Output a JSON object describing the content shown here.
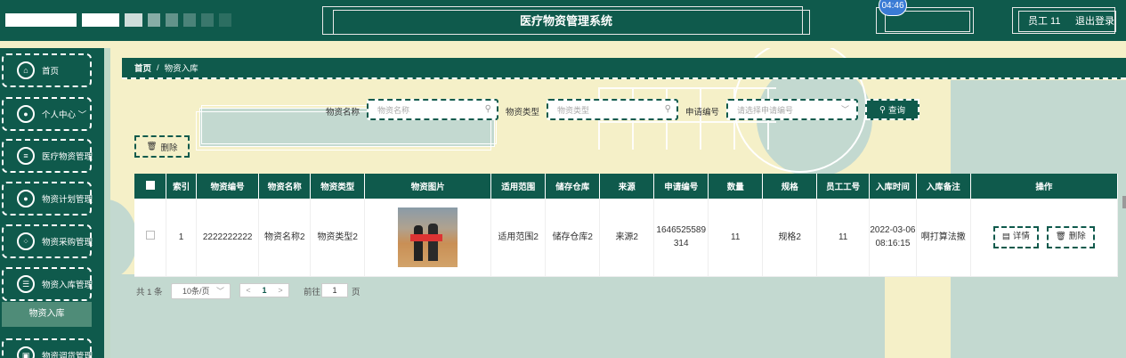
{
  "header": {
    "title": "医疗物资管理系统",
    "time": "04:46",
    "user": "员工 11",
    "logout": "退出登录"
  },
  "sidebar": {
    "items": [
      {
        "label": "首页",
        "icon": "home-icon"
      },
      {
        "label": "个人中心 ﹀",
        "icon": "user-icon"
      },
      {
        "label": "医疗物资管理",
        "icon": "box-icon"
      },
      {
        "label": "物资计划管理",
        "icon": "pin-icon"
      },
      {
        "label": "物资采购管理",
        "icon": "grid-icon"
      },
      {
        "label": "物资入库管理",
        "icon": "list-icon"
      },
      {
        "label": "物资调货管理",
        "icon": "box-icon"
      }
    ],
    "active_sub": "物资入库"
  },
  "breadcrumb": {
    "home": "首页",
    "sep": "/",
    "current": "物资入库"
  },
  "search": {
    "name_label": "物资名称",
    "name_placeholder": "物资名称",
    "type_label": "物资类型",
    "type_placeholder": "物资类型",
    "code_label": "申请编号",
    "code_placeholder": "请选择申请编号",
    "button": "查询"
  },
  "actions": {
    "delete": "删除"
  },
  "table": {
    "headers": [
      "",
      "索引",
      "物资编号",
      "物资名称",
      "物资类型",
      "物资图片",
      "适用范围",
      "储存仓库",
      "来源",
      "申请编号",
      "数量",
      "规格",
      "员工工号",
      "入库时间",
      "入库备注",
      "操作"
    ],
    "rows": [
      {
        "index": "1",
        "code": "2222222222",
        "name": "物资名称2",
        "type": "物资类型2",
        "scope": "适用范围2",
        "warehouse": "储存仓库2",
        "source": "来源2",
        "apply_no": "1646525589314",
        "qty": "11",
        "spec": "规格2",
        "staff_no": "11",
        "time": "2022-03-06 08:16:15",
        "remark": "啊打算法撒",
        "detail": "详情",
        "delete": "删除"
      }
    ]
  },
  "pagination": {
    "total": "共 1 条",
    "page_size": "10条/页",
    "prev": "<",
    "current": "1",
    "next": ">",
    "goto": "前往",
    "goto_value": "1",
    "page_unit": "页"
  }
}
